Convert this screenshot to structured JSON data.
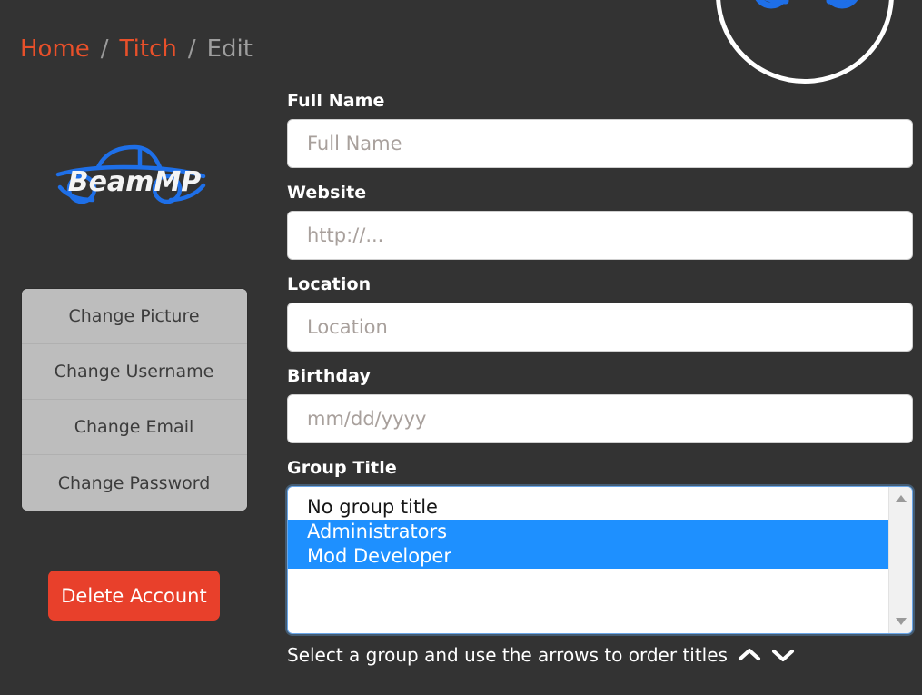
{
  "colors": {
    "page_background": "#333333",
    "breadcrumb_link": "#e8502a",
    "breadcrumb_current": "#9e9e9e",
    "list_group_background": "#bdbdbd",
    "delete_button": "#e8402b",
    "select_highlight": "#1e90ff",
    "logo_blue": "#1e6fe8",
    "input_background": "#ffffff",
    "placeholder": "#a8a09c"
  },
  "avatar": {
    "icon": "beammp-car-avatar",
    "alt": "user-avatar"
  },
  "breadcrumb": {
    "items": [
      {
        "label": "Home",
        "type": "link"
      },
      {
        "label": "Titch",
        "type": "link"
      },
      {
        "label": "Edit",
        "type": "current"
      }
    ],
    "separator": "/"
  },
  "sidebar": {
    "logo": {
      "text": "BeamMP",
      "icon": "beammp-logo"
    },
    "list_group": {
      "items": [
        {
          "label": "Change Picture",
          "name": "change-picture"
        },
        {
          "label": "Change Username",
          "name": "change-username"
        },
        {
          "label": "Change Email",
          "name": "change-email"
        },
        {
          "label": "Change Password",
          "name": "change-password"
        }
      ]
    },
    "delete_button": {
      "label": "Delete Account"
    }
  },
  "form": {
    "fields": [
      {
        "label": "Full Name",
        "placeholder": "Full Name",
        "value": "",
        "name": "full-name"
      },
      {
        "label": "Website",
        "placeholder": "http://...",
        "value": "",
        "name": "website"
      },
      {
        "label": "Location",
        "placeholder": "Location",
        "value": "",
        "name": "location"
      },
      {
        "label": "Birthday",
        "placeholder": "mm/dd/yyyy",
        "value": "",
        "name": "birthday"
      }
    ],
    "group_title": {
      "label": "Group Title",
      "options": [
        {
          "label": "No group title",
          "selected": false
        },
        {
          "label": "Administrators",
          "selected": true
        },
        {
          "label": "Mod Developer",
          "selected": true
        }
      ],
      "scrollbar": {
        "up_icon": "scroll-up-arrow-icon",
        "down_icon": "scroll-down-arrow-icon"
      },
      "help_text": "Select a group and use the arrows to order titles",
      "order_up_icon": "chevron-up-icon",
      "order_down_icon": "chevron-down-icon"
    }
  }
}
